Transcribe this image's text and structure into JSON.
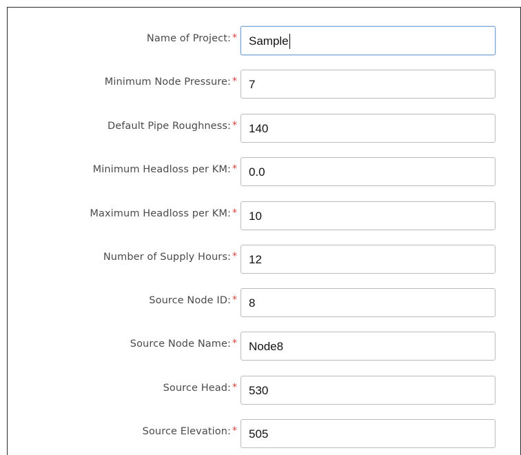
{
  "form": {
    "required_marker": "*",
    "fields": [
      {
        "label": "Name of Project:",
        "value": "Sample"
      },
      {
        "label": "Minimum Node Pressure:",
        "value": "7"
      },
      {
        "label": "Default Pipe Roughness:",
        "value": "140"
      },
      {
        "label": "Minimum Headloss per KM:",
        "value": "0.0"
      },
      {
        "label": "Maximum Headloss per KM:",
        "value": "10"
      },
      {
        "label": "Number of Supply Hours:",
        "value": "12"
      },
      {
        "label": "Source Node ID:",
        "value": "8"
      },
      {
        "label": "Source Node Name:",
        "value": "Node8"
      },
      {
        "label": "Source Head:",
        "value": "530"
      },
      {
        "label": "Source Elevation:",
        "value": "505"
      }
    ]
  },
  "colors": {
    "label_text": "#4a4a4a",
    "required_marker": "#d9413c",
    "input_border": "#b9bcc0",
    "focused_input_border": "#7fa8d6"
  }
}
